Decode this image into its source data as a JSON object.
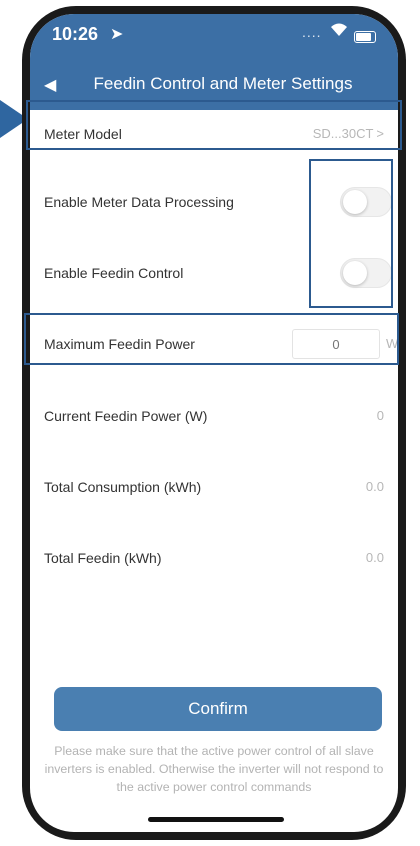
{
  "status_bar": {
    "time": "10:26",
    "location_glyph": "➤",
    "signal_glyph": "....",
    "wifi_glyph": "📶"
  },
  "nav": {
    "title": "Feedin Control and Meter Settings",
    "back_glyph": "◀"
  },
  "rows": {
    "meter_model": {
      "label": "Meter Model",
      "value": "SD...30CT",
      "chevron": ">"
    },
    "enable_meter_data": {
      "label": "Enable Meter Data Processing",
      "enabled": false
    },
    "enable_feedin": {
      "label": "Enable Feedin Control",
      "enabled": false
    },
    "max_feedin": {
      "label": "Maximum Feedin Power",
      "placeholder": "0",
      "unit": "W"
    },
    "current_feedin": {
      "label": "Current Feedin Power (W)",
      "value": "0"
    },
    "total_consumption": {
      "label": "Total Consumption (kWh)",
      "value": "0.0"
    },
    "total_feedin": {
      "label": "Total Feedin (kWh)",
      "value": "0.0"
    }
  },
  "confirm_label": "Confirm",
  "note": "Please make sure that the active power control of all slave inverters is enabled. Otherwise the inverter will not respond to the active power control commands",
  "colors": {
    "header": "#3c6fa5",
    "confirm": "#4a7fb1",
    "highlight": "#2c5a8f",
    "arrow": "#2f66a0"
  }
}
